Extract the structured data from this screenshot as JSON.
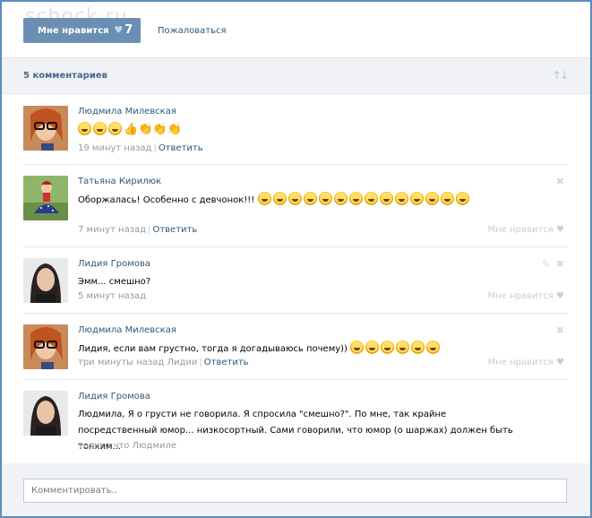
{
  "watermark": "schock.ru",
  "top": {
    "like_label": "Мне нравится",
    "like_count": "7",
    "report_label": "Пожаловаться"
  },
  "comments_header": {
    "title": "5 комментариев"
  },
  "comments": [
    {
      "author": "Людмила Милевская",
      "text": "",
      "time": "19 минут назад",
      "reply": "Ответить",
      "like": ""
    },
    {
      "author": "Татьяна Кирилюк",
      "text": "Оборжалась! Особенно с девчонок!!!",
      "time": "7 минут назад",
      "reply": "Ответить",
      "like": "Мне нравится"
    },
    {
      "author": "Лидия Громова",
      "text": "Эмм... смешно?",
      "time": "5 минут назад",
      "reply": "",
      "like": "Мне нравится"
    },
    {
      "author": "Людмила Милевская",
      "text": "Лидия, если вам грустно, тогда я догадываюсь почему))",
      "time": "три минуты назад Лидии",
      "reply": "Ответить",
      "like": "Мне нравится"
    },
    {
      "author": "Лидия Громова",
      "text": "Людмила, Я о грусти не говорила. Я спросила \"смешно?\". По мне, так крайне посредственный юмор... низкосортный. Сами говорили, что юмор (о шаржах) должен быть тонким...",
      "time": "только что Людмиле",
      "reply": "",
      "like": ""
    }
  ],
  "input": {
    "placeholder": "Комментировать.."
  },
  "colors": {
    "frame": "#5b8db8",
    "link": "#2b587a",
    "button": "#6b8fb3",
    "bar": "#f0f2f5"
  }
}
